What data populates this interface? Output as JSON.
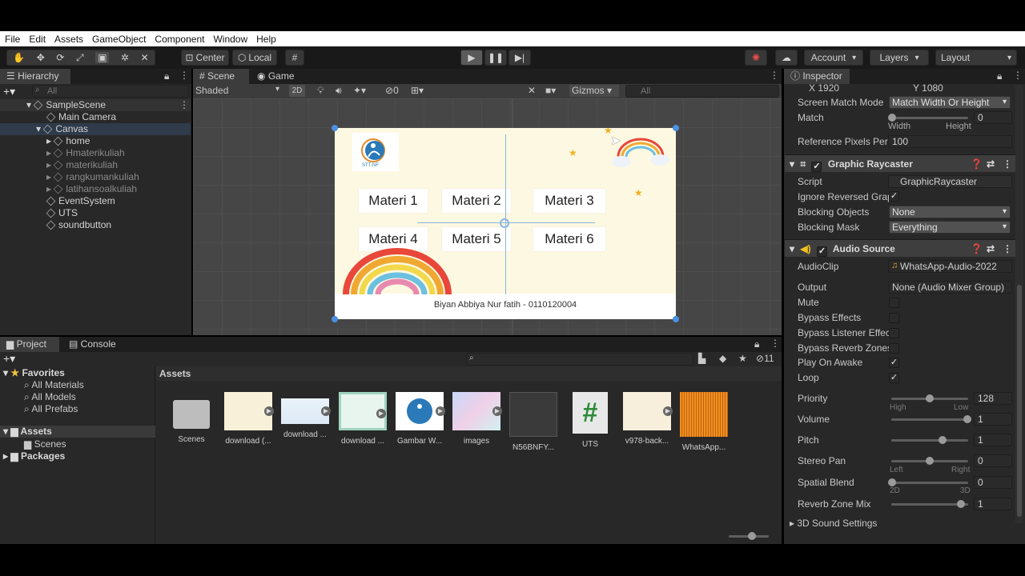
{
  "menu": [
    "File",
    "Edit",
    "Assets",
    "GameObject",
    "Component",
    "Window",
    "Help"
  ],
  "toolbar": {
    "pivot": "Center",
    "space": "Local",
    "account": "Account",
    "layers": "Layers",
    "layout": "Layout"
  },
  "hierarchy": {
    "tab": "Hierarchy",
    "search_placeholder": "All",
    "scene": "SampleScene",
    "items": [
      "Main Camera",
      "Canvas",
      "home",
      "Hmaterikuliah",
      "materikuliah",
      "rangkumankuliah",
      "latihansoalkuliah",
      "EventSystem",
      "UTS",
      "soundbutton"
    ]
  },
  "scene": {
    "tabs": [
      "Scene",
      "Game"
    ],
    "shading": "Shaded",
    "mode2d": "2D",
    "hidden_count": "0",
    "gizmos": "Gizmos",
    "search_placeholder": "All"
  },
  "canvas": {
    "logo_text": "STT-NF",
    "buttons": [
      "Materi 1",
      "Materi 2",
      "Materi 3",
      "Materi 4",
      "Materi 5",
      "Materi 6"
    ],
    "footer": "Biyan Abbiya Nur fatih - 0110120004"
  },
  "project": {
    "tabs": [
      "Project",
      "Console"
    ],
    "favorites_label": "Favorites",
    "favorites": [
      "All Materials",
      "All Models",
      "All Prefabs"
    ],
    "assets_label": "Assets",
    "scenes_label": "Scenes",
    "packages_label": "Packages",
    "breadcrumb": "Assets",
    "hidden_count": "11",
    "assets": [
      "Scenes",
      "download (...",
      "download ...",
      "download ...",
      "Gambar W...",
      "images",
      "N56BNFY...",
      "UTS",
      "v978-back...",
      "WhatsApp..."
    ]
  },
  "inspector": {
    "tab": "Inspector",
    "x_label": "X",
    "x_value": "1920",
    "y_label": "Y",
    "y_value": "1080",
    "screen_match_label": "Screen Match Mode",
    "screen_match_value": "Match Width Or Height",
    "match_label": "Match",
    "match_value": "0",
    "width_label": "Width",
    "height_label": "Height",
    "ref_ppu_label": "Reference Pixels Per",
    "ref_ppu_value": "100",
    "raycaster": {
      "title": "Graphic Raycaster",
      "script_label": "Script",
      "script_value": "GraphicRaycaster",
      "ignore_label": "Ignore Reversed Grap",
      "blocking_objects_label": "Blocking Objects",
      "blocking_objects_value": "None",
      "blocking_mask_label": "Blocking Mask",
      "blocking_mask_value": "Everything"
    },
    "audio": {
      "title": "Audio Source",
      "clip_label": "AudioClip",
      "clip_value": "WhatsApp-Audio-2022",
      "output_label": "Output",
      "output_value": "None (Audio Mixer Group)",
      "mute_label": "Mute",
      "bypass_effects_label": "Bypass Effects",
      "bypass_listener_label": "Bypass Listener Effec",
      "bypass_reverb_label": "Bypass Reverb Zones",
      "play_on_awake_label": "Play On Awake",
      "loop_label": "Loop",
      "priority_label": "Priority",
      "priority_value": "128",
      "priority_low": "High",
      "priority_high": "Low",
      "volume_label": "Volume",
      "volume_value": "1",
      "pitch_label": "Pitch",
      "pitch_value": "1",
      "stereo_label": "Stereo Pan",
      "stereo_value": "0",
      "stereo_left": "Left",
      "stereo_right": "Right",
      "spatial_label": "Spatial Blend",
      "spatial_value": "0",
      "spatial_2d": "2D",
      "spatial_3d": "3D",
      "reverb_label": "Reverb Zone Mix",
      "reverb_value": "1",
      "sound3d_label": "3D Sound Settings"
    }
  },
  "colors": {
    "canvas_bg": "#fdf8e1",
    "accent_blue": "#2a79b8"
  }
}
